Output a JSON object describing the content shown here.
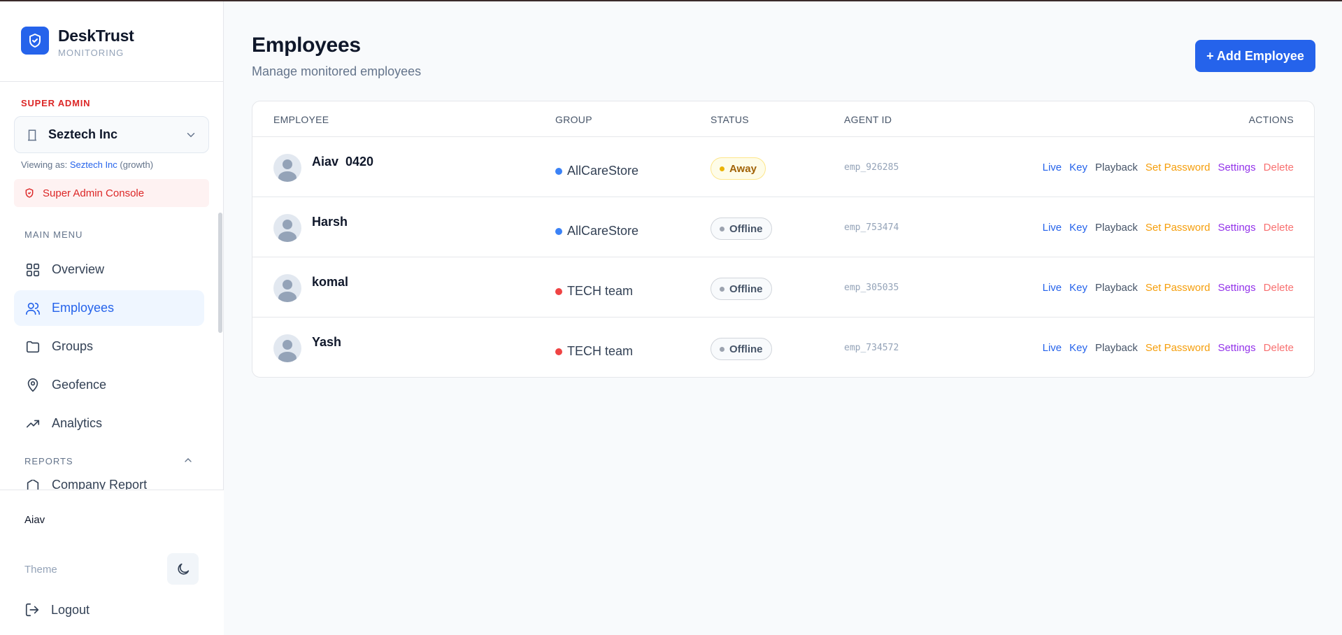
{
  "brand": {
    "name": "DeskTrust",
    "subtitle": "MONITORING"
  },
  "sidebar": {
    "admin_label": "SUPER ADMIN",
    "org_select": {
      "value": "Seztech Inc"
    },
    "viewing": {
      "prefix": "Viewing as: ",
      "org": "Seztech Inc",
      "plan": " (growth)"
    },
    "console_label": "Super Admin Console",
    "main_menu_label": "MAIN MENU",
    "items": [
      {
        "label": "Overview",
        "icon": "grid-icon"
      },
      {
        "label": "Employees",
        "icon": "users-icon",
        "active": true
      },
      {
        "label": "Groups",
        "icon": "folder-icon"
      },
      {
        "label": "Geofence",
        "icon": "map-pin-icon"
      },
      {
        "label": "Analytics",
        "icon": "trending-up-icon"
      }
    ],
    "reports_label": "REPORTS",
    "reports_first_item": "Company Report",
    "user": "Aiav",
    "theme_label": "Theme",
    "logout_label": "Logout"
  },
  "page": {
    "title": "Employees",
    "subtitle": "Manage monitored employees",
    "add_button": "+ Add Employee"
  },
  "table": {
    "headers": {
      "employee": "EMPLOYEE",
      "group": "GROUP",
      "status": "STATUS",
      "agent_id": "AGENT ID",
      "actions": "ACTIONS"
    },
    "action_labels": {
      "live": "Live",
      "key": "Key",
      "playback": "Playback",
      "set_password": "Set Password",
      "settings": "Settings",
      "delete": "Delete"
    },
    "rows": [
      {
        "name": "Aiav  0420",
        "group": "AllCareStore",
        "group_color": "#3b82f6",
        "status": "Away",
        "agent_id": "emp_926285"
      },
      {
        "name": "Harsh",
        "group": "AllCareStore",
        "group_color": "#3b82f6",
        "status": "Offline",
        "agent_id": "emp_753474"
      },
      {
        "name": "komal",
        "group": "TECH team",
        "group_color": "#ef4444",
        "status": "Offline",
        "agent_id": "emp_305035"
      },
      {
        "name": "Yash",
        "group": "TECH team",
        "group_color": "#ef4444",
        "status": "Offline",
        "agent_id": "emp_734572"
      }
    ]
  },
  "colors": {
    "accent": "#2563eb",
    "danger": "#dc2626"
  }
}
